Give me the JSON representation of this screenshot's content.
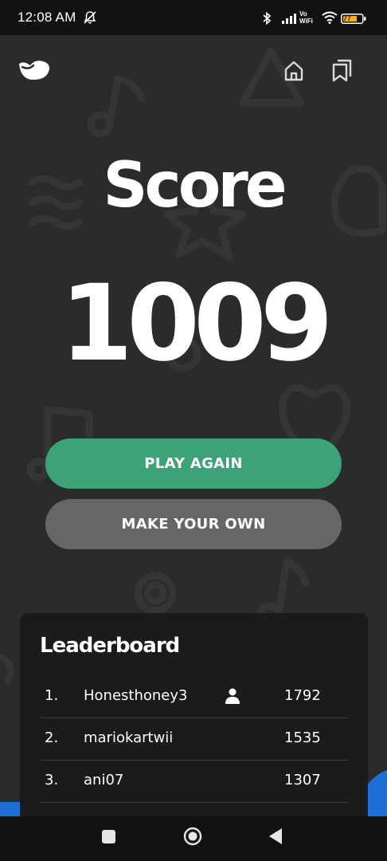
{
  "status_bar": {
    "time": "12:08 AM",
    "vowifi_top": "Vo",
    "vowifi_bottom": "WiFi",
    "battery_level": "77",
    "icons": [
      "bell-off-icon",
      "bluetooth-icon",
      "signal-icon",
      "wifi-icon",
      "battery-icon"
    ]
  },
  "header": {
    "icons": [
      "logo-icon",
      "home-icon",
      "bookmark-icon"
    ]
  },
  "score": {
    "title": "Score",
    "value": "1009"
  },
  "buttons": {
    "play_again": "PLAY AGAIN",
    "make_your_own": "MAKE YOUR OWN"
  },
  "leaderboard": {
    "title": "Leaderboard",
    "rows": [
      {
        "rank": "1.",
        "name": "Honesthoney3",
        "score": "1792",
        "is_current_user": true
      },
      {
        "rank": "2.",
        "name": "mariokartwii",
        "score": "1535"
      },
      {
        "rank": "3.",
        "name": "ani07",
        "score": "1307"
      }
    ]
  },
  "colors": {
    "background": "#2b2b2b",
    "play_again": "#3ba376",
    "make_your_own": "#666666",
    "leaderboard_bg": "#1b1b1b",
    "accent_blue": "#1d6fd6"
  },
  "nav_bar": {
    "icons": [
      "recents-icon",
      "home-nav-icon",
      "back-icon"
    ]
  }
}
